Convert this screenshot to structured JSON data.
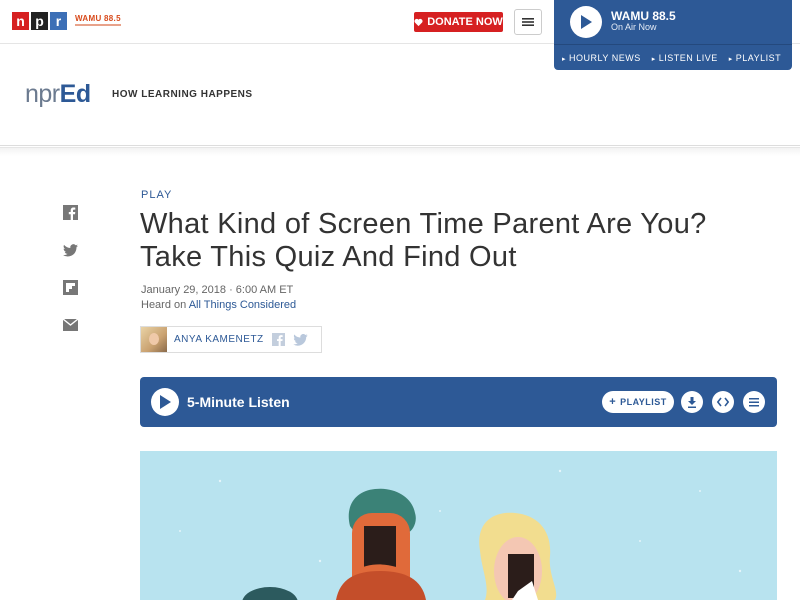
{
  "header": {
    "npr_logo_letters": [
      "n",
      "p",
      "r"
    ],
    "station_brand": "WAMU 88.5",
    "donate_label": "DONATE NOW",
    "colors": {
      "npr_red": "#d62021",
      "npr_blue": "#2d5996"
    }
  },
  "station_player": {
    "name": "WAMU 88.5",
    "status": "On Air Now",
    "links": [
      "HOURLY NEWS",
      "LISTEN LIVE",
      "PLAYLIST"
    ]
  },
  "section": {
    "logo_prefix": "npr",
    "logo_suffix": "Ed",
    "tagline": "HOW LEARNING HAPPENS"
  },
  "share_icons": [
    "facebook-icon",
    "twitter-icon",
    "flipboard-icon",
    "email-icon"
  ],
  "article": {
    "slug": "PLAY",
    "title_line1": "What Kind of Screen Time Parent Are You?",
    "title_line2": "Take This Quiz And Find Out",
    "dateline": "January 29, 2018 · 6:00 AM ET",
    "heard_on_prefix": "Heard on",
    "heard_on_program": "All Things Considered",
    "author": "ANYA KAMENETZ"
  },
  "audio": {
    "title": "5-Minute Listen",
    "playlist_label": "PLAYLIST"
  }
}
